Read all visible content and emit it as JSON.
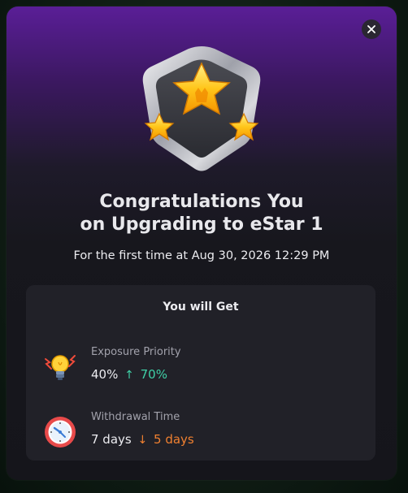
{
  "modal": {
    "title_line1": "Congratulations You",
    "title_line2": "on Upgrading to eStar 1",
    "subtitle": "For the first time at Aug 30, 2026 12:29 PM",
    "close_icon": "close-icon",
    "badge_icon": "estar-badge-icon"
  },
  "benefits": {
    "title": "You will Get",
    "items": [
      {
        "icon": "lightbulb-icon",
        "label": "Exposure Priority",
        "old_value": "40%",
        "arrow": "↑",
        "new_value": "70%",
        "change_color": "#3fd1a7"
      },
      {
        "icon": "clock-icon",
        "label": "Withdrawal Time",
        "old_value": "7 days",
        "arrow": "↓",
        "new_value": "5 days",
        "change_color": "#f08030"
      }
    ]
  },
  "colors": {
    "accent_up": "#3fd1a7",
    "accent_down": "#f08030",
    "header_purple": "#5a1e97"
  }
}
